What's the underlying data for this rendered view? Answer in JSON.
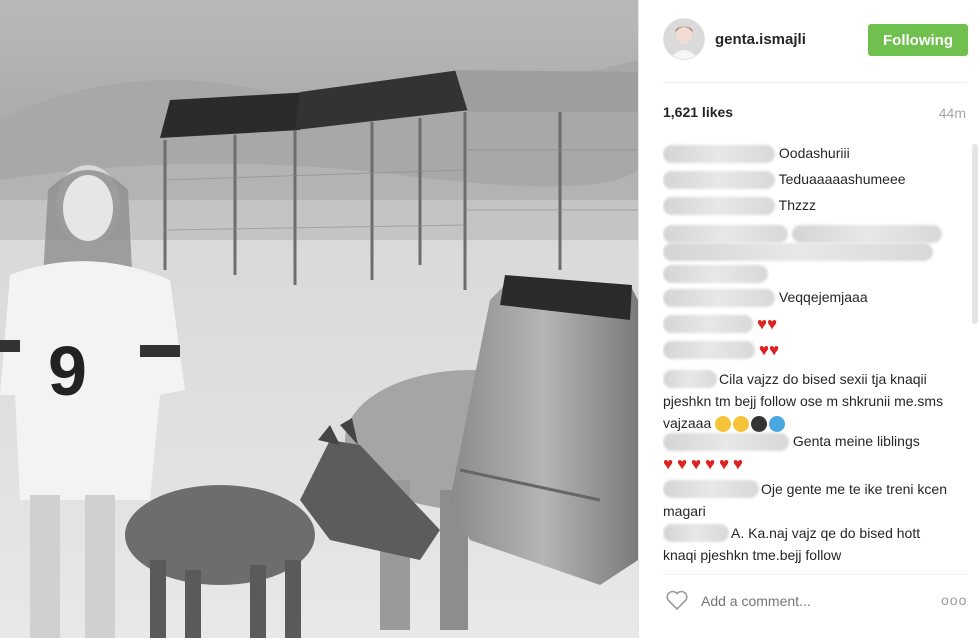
{
  "post": {
    "username": "genta.ismajli",
    "follow_label": "Following",
    "likes": "1,621 likes",
    "time_ago": "44m",
    "comment_placeholder": "Add a comment...",
    "more_label": "ooo"
  },
  "comments": [
    {
      "text": "Oodashuriii"
    },
    {
      "text": "Teduaaaaashumeee"
    },
    {
      "text": "Thzzz"
    },
    {
      "text": ""
    },
    {
      "text": ""
    },
    {
      "text": "Veqqejemjaaa"
    },
    {
      "text": ""
    },
    {
      "text": ""
    },
    {
      "text": "Cila vajzz do bised sexii tja knaqii pjeshkn tm bejj follow ose m shkrunii me.sms vajzaaa"
    },
    {
      "text": "Genta meine liblings"
    },
    {
      "text": "Oje gente me te ike treni kcen magari"
    },
    {
      "text": "A. Ka.naj vajz qe do bised hott knaqi pjeshkn tme.bejj follow"
    }
  ],
  "colors": {
    "follow_green": "#70c050",
    "heart_red": "#d22222"
  },
  "icons": [
    "heart-icon",
    "more-options-icon",
    "emoji-icon"
  ]
}
